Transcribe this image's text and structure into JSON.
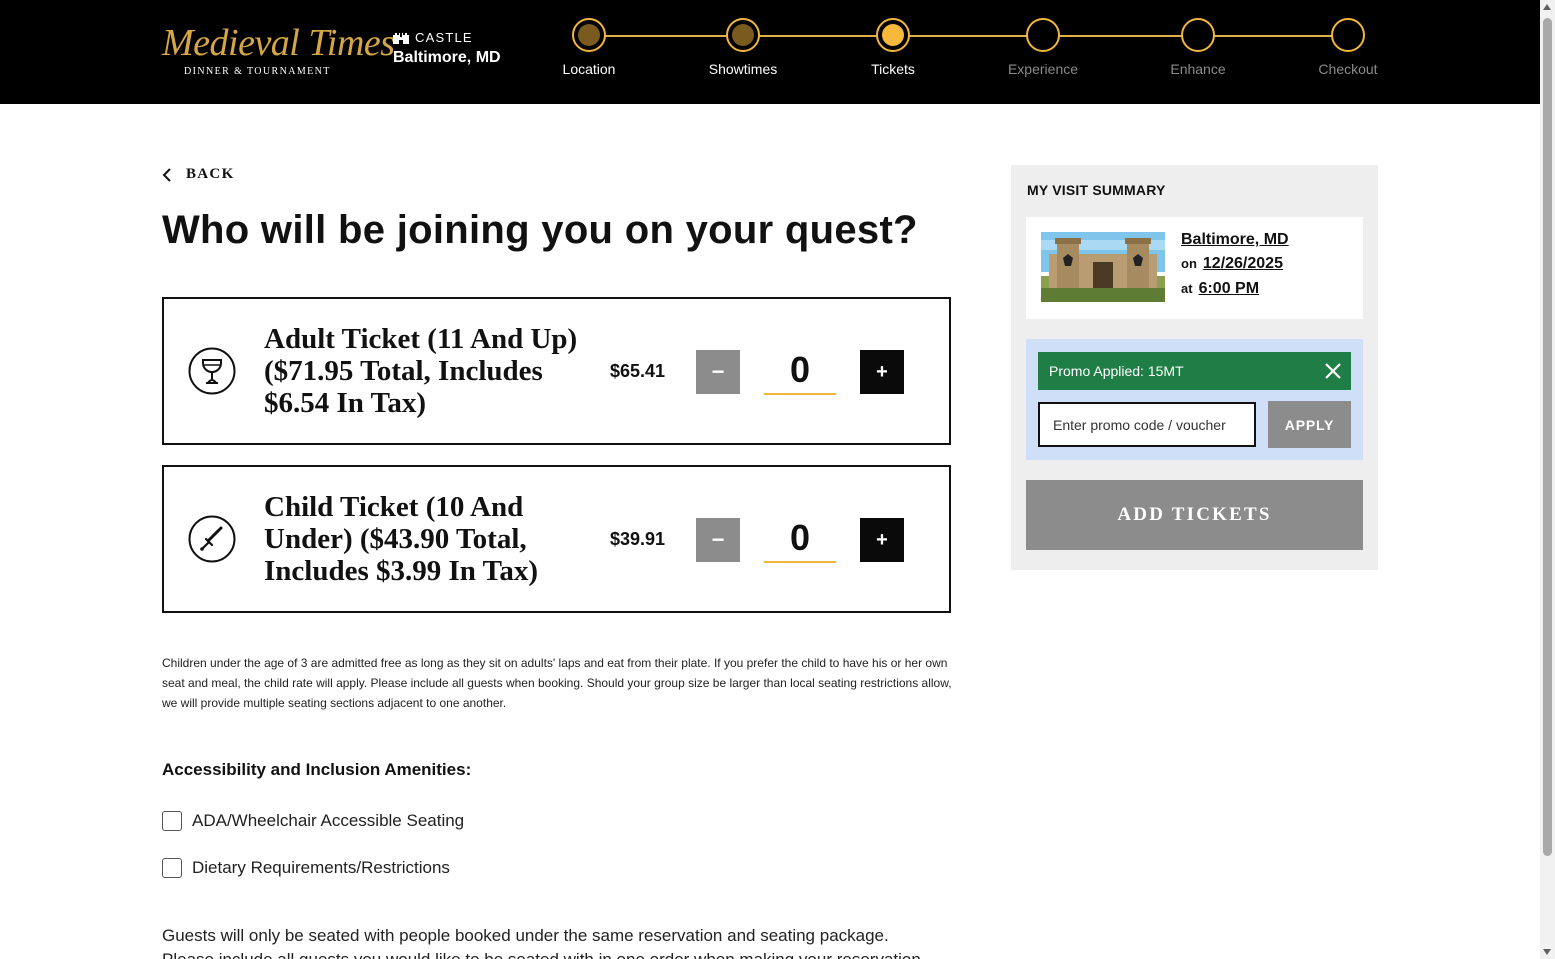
{
  "header": {
    "logo_main": "Medieval Times",
    "logo_sub": "DINNER & TOURNAMENT",
    "castle_label": "CASTLE",
    "castle_name": "Baltimore, MD",
    "steps": [
      {
        "label": "Location",
        "state": "done"
      },
      {
        "label": "Showtimes",
        "state": "done"
      },
      {
        "label": "Tickets",
        "state": "current"
      },
      {
        "label": "Experience",
        "state": "future"
      },
      {
        "label": "Enhance",
        "state": "future"
      },
      {
        "label": "Checkout",
        "state": "future"
      }
    ],
    "colors": {
      "done": "#7a5a1e",
      "current": "#f6b93b",
      "line": "#e2b24a"
    }
  },
  "main": {
    "back_label": "BACK",
    "title": "Who will be joining you on your quest?",
    "tickets": [
      {
        "name": "Adult Ticket (11 And Up) ($71.95 Total, Includes $6.54 In Tax)",
        "price": "$65.41",
        "quantity": "0",
        "icon": "goblet-icon"
      },
      {
        "name": "Child Ticket (10 And Under) ($43.90 Total, Includes $3.99 In Tax)",
        "price": "$39.91",
        "quantity": "0",
        "icon": "sword-icon"
      }
    ],
    "minus_label": "−",
    "plus_label": "+",
    "child_note": "Children under the age of 3 are admitted free as long as they sit on adults' laps and eat from their plate. If you prefer the child to have his or her own seat and meal, the child rate will apply. Please include all guests when booking. Should your group size be larger than local seating restrictions allow, we will provide multiple seating sections adjacent to one another.",
    "amenities_title": "Accessibility and Inclusion Amenities:",
    "amenities": [
      {
        "label": "ADA/Wheelchair Accessible Seating",
        "checked": false
      },
      {
        "label": "Dietary Requirements/Restrictions",
        "checked": false
      }
    ],
    "guests_note": "Guests will only be seated with people booked under the same reservation and seating package. Please include all guests you would like to be seated with in one order when making your reservation."
  },
  "summary": {
    "title": "MY VISIT SUMMARY",
    "location": "Baltimore, MD",
    "on_label": "on",
    "date": "12/26/2025",
    "at_label": "at",
    "time": "6:00 PM",
    "promo_applied": "Promo Applied: 15MT",
    "promo_placeholder": "Enter promo code / voucher",
    "apply_label": "APPLY",
    "add_tickets_label": "ADD TICKETS"
  }
}
